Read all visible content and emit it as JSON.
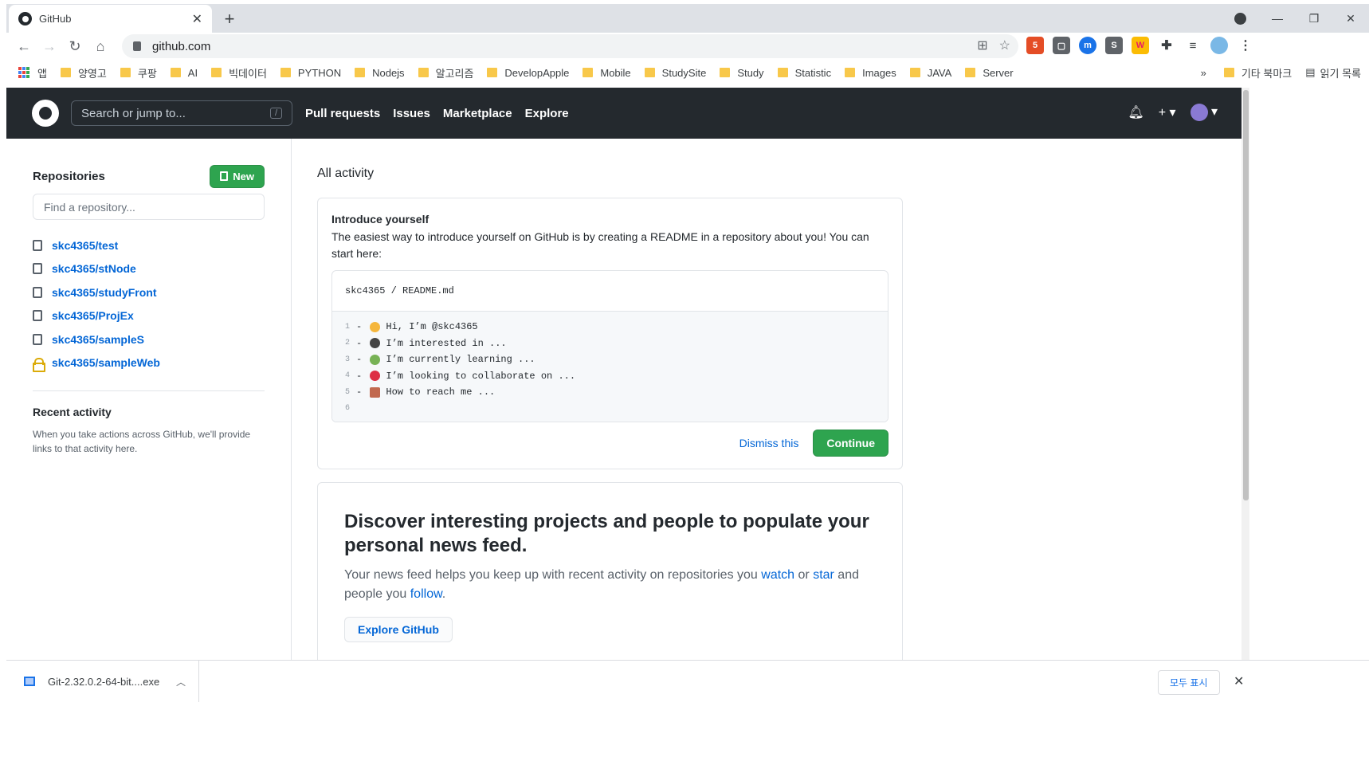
{
  "browser": {
    "tab_title": "GitHub",
    "url": "github.com",
    "bookmarks": [
      "앱",
      "양영고",
      "쿠팡",
      "AI",
      "빅데이터",
      "PYTHON",
      "Nodejs",
      "알고리즘",
      "DevelopApple",
      "Mobile",
      "StudySite",
      "Study",
      "Statistic",
      "Images",
      "JAVA",
      "Server"
    ],
    "bookmarks_overflow": "»",
    "other_bookmarks": "기타 북마크",
    "reading_list": "읽기 목록"
  },
  "header": {
    "search_placeholder": "Search or jump to...",
    "search_shortcut": "/",
    "nav": [
      "Pull requests",
      "Issues",
      "Marketplace",
      "Explore"
    ]
  },
  "sidebar": {
    "repositories_title": "Repositories",
    "new_button": "New",
    "find_placeholder": "Find a repository...",
    "repos": [
      {
        "name": "skc4365/test",
        "private": false
      },
      {
        "name": "skc4365/stNode",
        "private": false
      },
      {
        "name": "skc4365/studyFront",
        "private": false
      },
      {
        "name": "skc4365/ProjEx",
        "private": false
      },
      {
        "name": "skc4365/sampleS",
        "private": false
      },
      {
        "name": "skc4365/sampleWeb",
        "private": true
      }
    ],
    "recent_title": "Recent activity",
    "recent_text": "When you take actions across GitHub, we'll provide links to that activity here."
  },
  "main": {
    "all_activity": "All activity",
    "intro": {
      "title": "Introduce yourself",
      "text": "The easiest way to introduce yourself on GitHub is by creating a README in a repository about you! You can start here:",
      "readme_path": "skc4365 / README.md",
      "lines": [
        {
          "n": "1",
          "text": "- ",
          "emoji_color": "#f5b63c",
          "rest": "Hi, I’m @skc4365"
        },
        {
          "n": "2",
          "text": "- ",
          "emoji_color": "#444444",
          "rest": "I’m interested in ..."
        },
        {
          "n": "3",
          "text": "- ",
          "emoji_color": "#77b255",
          "rest": "I’m currently learning ..."
        },
        {
          "n": "4",
          "text": "- ",
          "emoji_color": "#dd2e44",
          "rest": "I’m looking to collaborate on ..."
        },
        {
          "n": "5",
          "text": "- ",
          "emoji_color": "#c1694f",
          "rest": "How to reach me ..."
        },
        {
          "n": "6",
          "text": "",
          "emoji_color": "",
          "rest": ""
        }
      ],
      "dismiss": "Dismiss this",
      "continue": "Continue"
    },
    "discover": {
      "title": "Discover interesting projects and people to populate your personal news feed.",
      "text_1": "Your news feed helps you keep up with recent activity on repositories you ",
      "watch": "watch",
      "text_2": " or ",
      "star": "star",
      "text_3": " and people you ",
      "follow": "follow",
      "text_4": ".",
      "explore_button": "Explore GitHub"
    }
  },
  "downloads": {
    "file": "Git-2.32.0.2-64-bit....exe",
    "show_all": "모두 표시"
  }
}
